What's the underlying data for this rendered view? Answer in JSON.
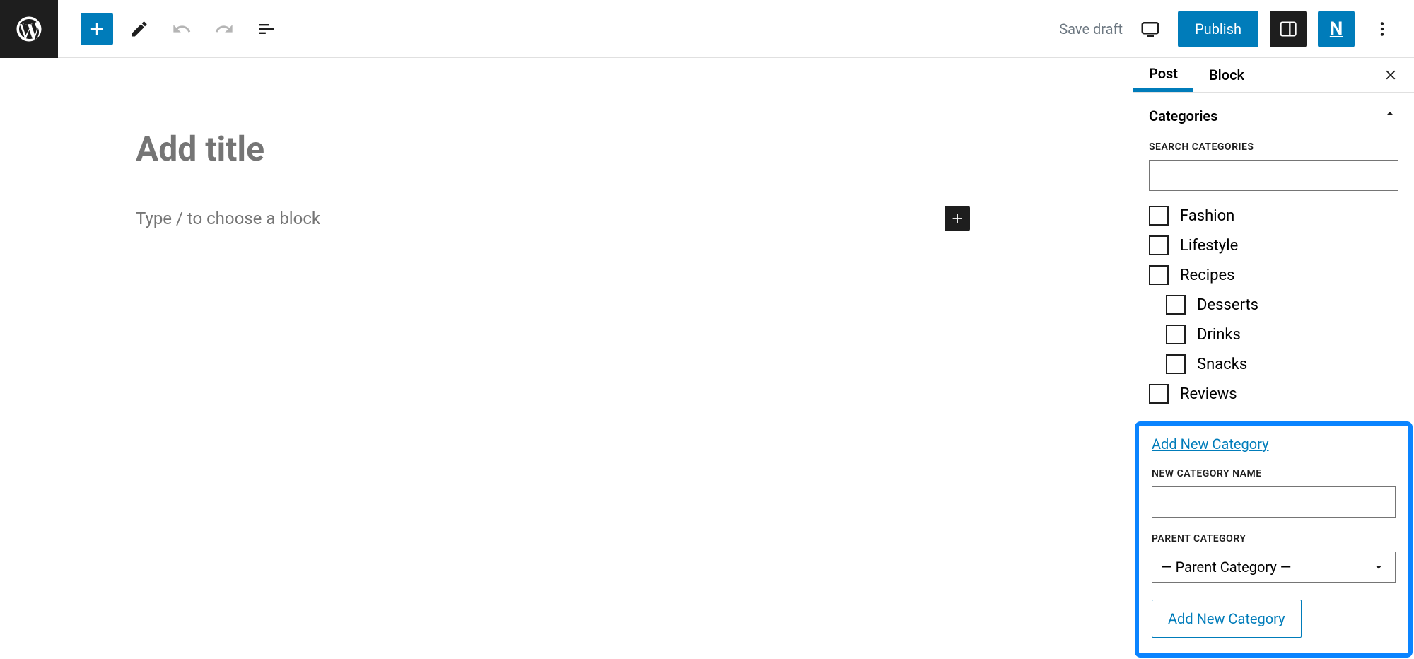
{
  "toolbar": {
    "save_draft": "Save draft",
    "publish": "Publish"
  },
  "editor": {
    "title_placeholder": "Add title",
    "body_placeholder": "Type / to choose a block"
  },
  "sidebar": {
    "tabs": {
      "post": "Post",
      "block": "Block"
    },
    "categories": {
      "heading": "Categories",
      "search_label": "SEARCH CATEGORIES",
      "items": [
        {
          "label": "Fashion",
          "child": false
        },
        {
          "label": "Lifestyle",
          "child": false
        },
        {
          "label": "Recipes",
          "child": false
        },
        {
          "label": "Desserts",
          "child": true
        },
        {
          "label": "Drinks",
          "child": true
        },
        {
          "label": "Snacks",
          "child": true
        },
        {
          "label": "Reviews",
          "child": false
        }
      ],
      "add_link": "Add New Category",
      "new_name_label": "NEW CATEGORY NAME",
      "parent_label": "PARENT CATEGORY",
      "parent_placeholder": "— Parent Category —",
      "add_button": "Add New Category"
    }
  }
}
